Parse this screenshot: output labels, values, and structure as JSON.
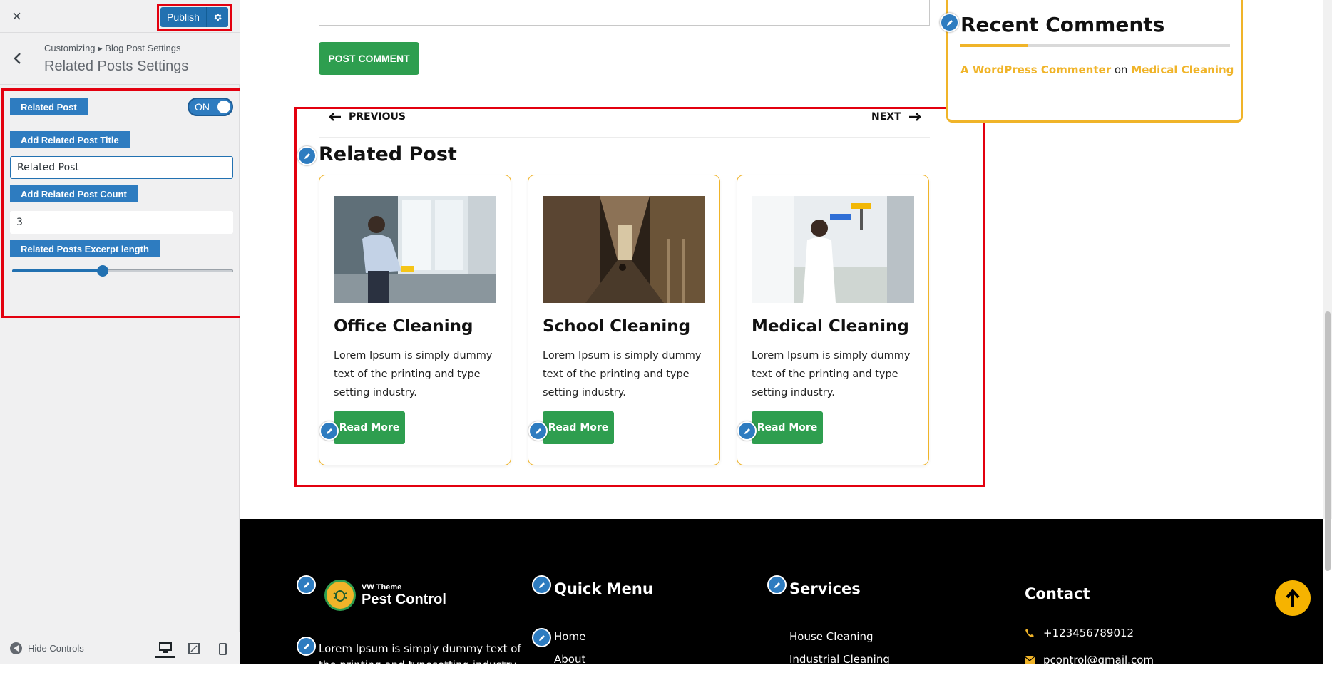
{
  "sidebar": {
    "close_icon": "×",
    "publish_label": "Publish",
    "breadcrumb": "Customizing ▸ Blog Post Settings",
    "section_title": "Related Posts Settings",
    "related_post_label": "Related Post",
    "toggle_state": "ON",
    "title_label": "Add Related Post Title",
    "title_value": "Related Post",
    "count_label": "Add Related Post Count",
    "count_value": "3",
    "excerpt_label": "Related Posts Excerpt length",
    "excerpt_slider_fraction": 0.41,
    "hide_controls": "Hide Controls"
  },
  "preview": {
    "post_comment_button": "POST COMMENT",
    "prev_label": "PREVIOUS",
    "next_label": "NEXT",
    "related_heading": "Related Post",
    "cards": [
      {
        "title": "Office Cleaning",
        "excerpt": "Lorem Ipsum is simply dummy text of the printing and type setting industry.",
        "button": "Read More"
      },
      {
        "title": "School Cleaning",
        "excerpt": "Lorem Ipsum is simply dummy text of the printing and type setting industry.",
        "button": "Read More"
      },
      {
        "title": "Medical Cleaning",
        "excerpt": "Lorem Ipsum is simply dummy text of the printing and type setting industry.",
        "button": "Read More"
      }
    ],
    "recent_comments": {
      "title": "Recent Comments",
      "author": "A WordPress Commenter",
      "on": "on",
      "post": "Medical Cleaning"
    }
  },
  "footer": {
    "logo_small": "VW Theme",
    "logo_big": "Pest Control",
    "about_text": "Lorem Ipsum is simply dummy text of the printing and typesetting industry. Lorem",
    "quick_menu_title": "Quick Menu",
    "quick_menu_items": [
      "Home",
      "About"
    ],
    "services_title": "Services",
    "services_items": [
      "House Cleaning",
      "Industrial Cleaning"
    ],
    "contact_title": "Contact",
    "phone": "+123456789012",
    "email": "pcontrol@gmail.com"
  },
  "colors": {
    "accent_blue": "#2e7cc0",
    "wp_blue": "#2271b1",
    "green": "#2e9e4f",
    "gold": "#f0b429",
    "highlight_red": "#e3000f"
  }
}
